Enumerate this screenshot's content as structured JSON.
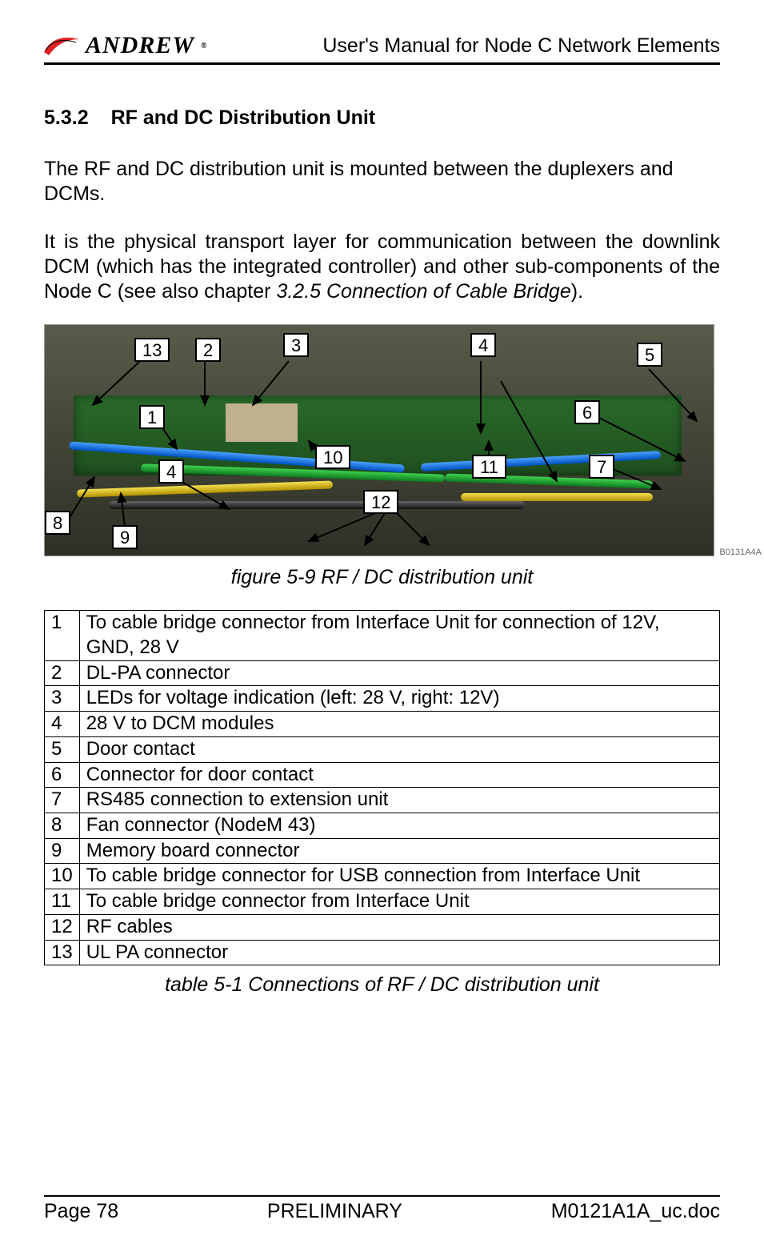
{
  "header": {
    "logo_text": "ANDREW",
    "doc_title": "User's Manual for Node C Network Elements"
  },
  "section": {
    "number": "5.3.2",
    "title": "RF and DC Distribution Unit"
  },
  "paragraphs": {
    "p1": "The RF and DC distribution unit is mounted between the duplexers and DCMs.",
    "p2_a": "It is the physical transport layer for communication between the downlink DCM (which has the integrated controller) and other sub-components of the Node C (see also chapter ",
    "p2_ref": "3.2.5 Connection of Cable Bridge",
    "p2_b": ")."
  },
  "figure": {
    "caption": "figure 5-9 RF / DC distribution unit",
    "image_tag": "B0131A4A",
    "labels": {
      "l1": "1",
      "l2": "2",
      "l3": "3",
      "l4a": "4",
      "l4b": "4",
      "l5": "5",
      "l6": "6",
      "l7": "7",
      "l8": "8",
      "l9": "9",
      "l10": "10",
      "l11": "11",
      "l12": "12",
      "l13": "13"
    }
  },
  "table": {
    "caption": "table 5-1 Connections of RF / DC distribution unit",
    "rows": [
      {
        "n": "1",
        "d": "To cable bridge connector from Interface Unit for connection of 12V, GND, 28 V"
      },
      {
        "n": "2",
        "d": "DL-PA connector"
      },
      {
        "n": "3",
        "d": "LEDs for voltage indication (left: 28 V, right: 12V)"
      },
      {
        "n": "4",
        "d": "28 V to DCM modules"
      },
      {
        "n": "5",
        "d": "Door contact"
      },
      {
        "n": "6",
        "d": "Connector for door contact"
      },
      {
        "n": "7",
        "d": "RS485 connection to extension unit"
      },
      {
        "n": "8",
        "d": "Fan connector (NodeM 43)"
      },
      {
        "n": "9",
        "d": "Memory board connector"
      },
      {
        "n": "10",
        "d": "To cable bridge connector for USB connection from Interface Unit"
      },
      {
        "n": "11",
        "d": "To cable bridge connector from Interface Unit"
      },
      {
        "n": "12",
        "d": "RF cables"
      },
      {
        "n": "13",
        "d": "UL PA connector"
      }
    ]
  },
  "footer": {
    "left": "Page 78",
    "center": "PRELIMINARY",
    "right": "M0121A1A_uc.doc"
  }
}
